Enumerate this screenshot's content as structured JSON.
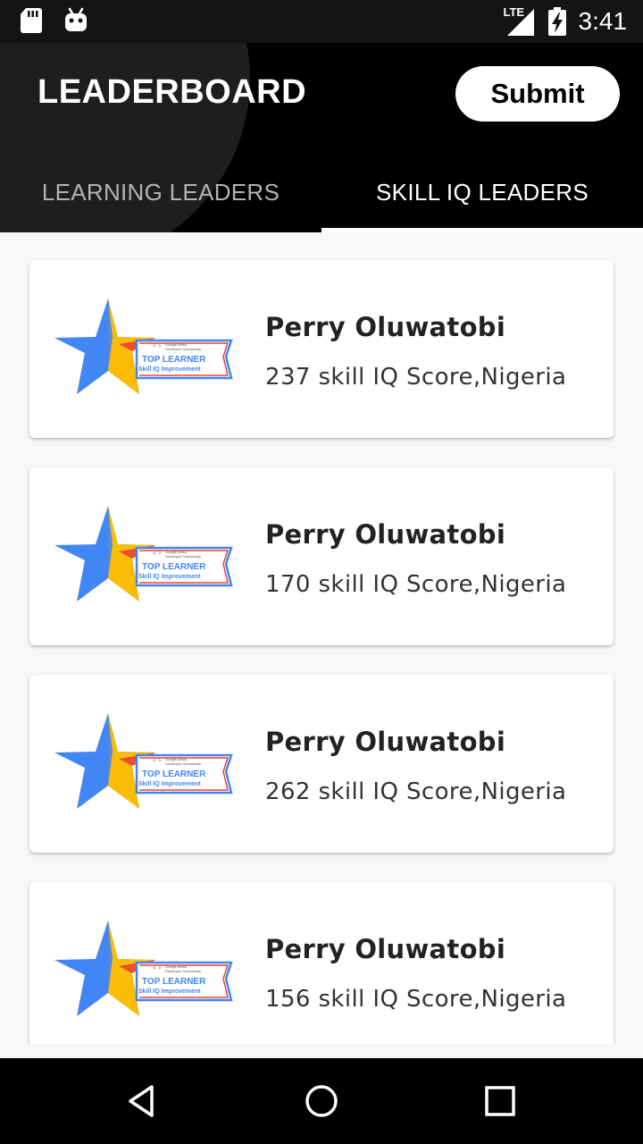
{
  "status_bar": {
    "time": "3:41",
    "network": "LTE",
    "icons": [
      "sd-card-icon",
      "android-icon",
      "signal-icon",
      "battery-charging-icon"
    ]
  },
  "app_bar": {
    "title": "LEADERBOARD",
    "submit_label": "Submit"
  },
  "tabs": [
    {
      "label": "LEARNING LEADERS",
      "active": false
    },
    {
      "label": "SKILL IQ LEADERS",
      "active": true
    }
  ],
  "badge": {
    "line1": "Google Africa",
    "line2": "Developer Scholarship",
    "title": "TOP LEARNER",
    "subtitle": "Skill IQ Improvement"
  },
  "leaders": [
    {
      "name": "Perry Oluwatobi",
      "score": "237 skill IQ Score,Nigeria"
    },
    {
      "name": "Perry Oluwatobi",
      "score": "170 skill IQ Score,Nigeria"
    },
    {
      "name": "Perry Oluwatobi",
      "score": "262 skill IQ Score,Nigeria"
    },
    {
      "name": "Perry Oluwatobi",
      "score": "156 skill IQ Score,Nigeria"
    }
  ],
  "nav_bar": {
    "icons": [
      "back-icon",
      "home-icon",
      "recents-icon"
    ]
  },
  "colors": {
    "star_blue": "#4285f4",
    "star_gold": "#fbbc05",
    "banner_red": "#ea4335",
    "app_bar": "#000000"
  }
}
